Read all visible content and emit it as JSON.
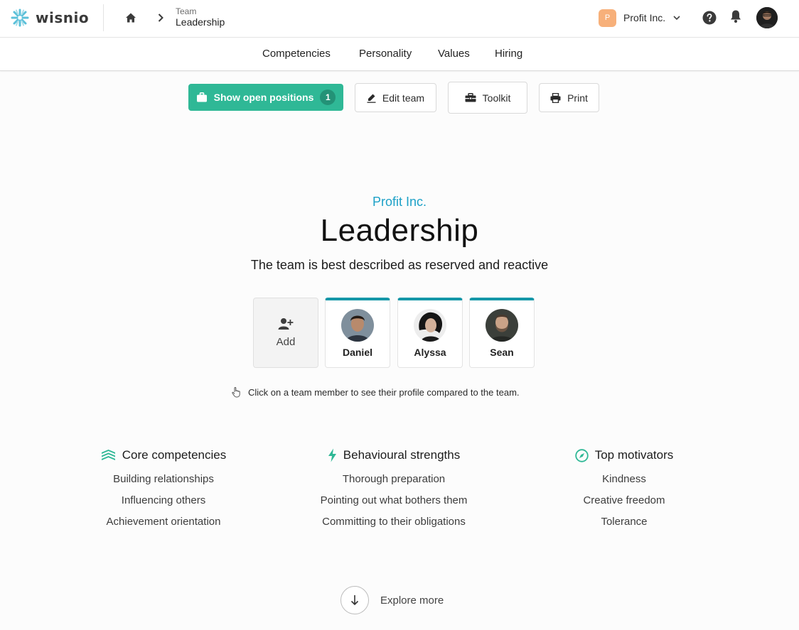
{
  "header": {
    "logo_text": "wisnio",
    "breadcrumb_parent": "Team",
    "breadcrumb_current": "Leadership",
    "org_initial": "P",
    "org_name": "Profit Inc."
  },
  "tabs": [
    "Competencies",
    "Personality",
    "Values",
    "Hiring"
  ],
  "toolbar": {
    "open_positions_label": "Show open positions",
    "open_positions_count": "1",
    "edit_label": "Edit team",
    "toolkit_label": "Toolkit",
    "print_label": "Print"
  },
  "hero": {
    "company": "Profit Inc.",
    "title": "Leadership",
    "description": "The team is best described as reserved and reactive"
  },
  "members": {
    "add_label": "Add",
    "list": [
      "Daniel",
      "Alyssa",
      "Sean"
    ]
  },
  "hint": "Click on a team member to see their profile compared to the team.",
  "columns": [
    {
      "title": "Core competencies",
      "icon": "layers-icon",
      "items": [
        "Building relationships",
        "Influencing others",
        "Achievement orientation"
      ]
    },
    {
      "title": "Behavioural strengths",
      "icon": "bolt-icon",
      "items": [
        "Thorough preparation",
        "Pointing out what bothers them",
        "Committing to their obligations"
      ]
    },
    {
      "title": "Top motivators",
      "icon": "compass-icon",
      "items": [
        "Kindness",
        "Creative freedom",
        "Tolerance"
      ]
    }
  ],
  "explore_label": "Explore more",
  "colors": {
    "accent_green": "#2fb896",
    "accent_teal": "#1597a8",
    "company_blue": "#1da1c7",
    "org_badge": "#f7b07a"
  }
}
